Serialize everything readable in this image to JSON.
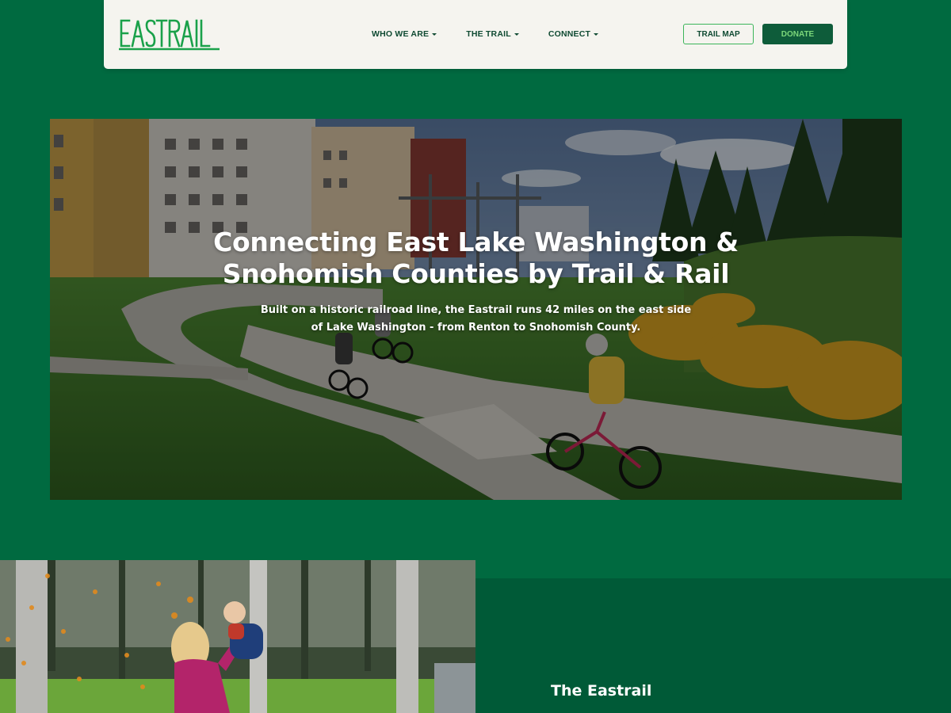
{
  "header": {
    "logo_text": "EASTRAIL",
    "nav": [
      {
        "label": "WHO WE ARE",
        "icon": "chevron-down-icon"
      },
      {
        "label": "THE TRAIL",
        "icon": "chevron-down-icon"
      },
      {
        "label": "CONNECT",
        "icon": "chevron-down-icon"
      }
    ],
    "trail_map_label": "TRAIL MAP",
    "donate_label": "DONATE"
  },
  "hero": {
    "title_line1": "Connecting East Lake Washington &",
    "title_line2": "Snohomish Counties by Trail & Rail",
    "subtitle_line1": "Built on a historic railroad line, the Eastrail runs 42 miles on the east side",
    "subtitle_line2": "of Lake Washington -  from Renton to Snohomish County.",
    "image": "cyclists-on-trail-photo"
  },
  "section": {
    "image": "mother-and-baby-in-park-photo",
    "heading": "The Eastrail"
  },
  "colors": {
    "page_bg": "#006a40",
    "header_bg": "#f5f4ef",
    "brand_green": "#1aa14a",
    "nav_text": "#0f4a32",
    "donate_bg": "#0e5c3a",
    "donate_text": "#7bd67a",
    "panel_bg": "#005a37"
  }
}
